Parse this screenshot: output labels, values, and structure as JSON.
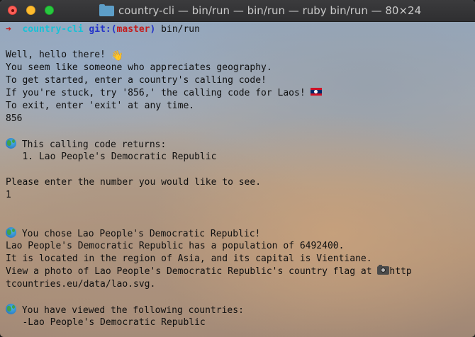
{
  "window": {
    "title": "country-cli — bin/run — bin/run — ruby bin/run — 80×24"
  },
  "prompt": {
    "arrow": "➜",
    "directory": "country-cli",
    "git_label": "git:(",
    "branch": "master",
    "git_close": ")",
    "command": "bin/run"
  },
  "greeting": {
    "hello": "Well, hello there! ",
    "line_geography": "You seem like someone who appreciates geography.",
    "line_start": "To get started, enter a country's calling code!",
    "line_stuck": "If you're stuck, try '856,' the calling code for Laos! ",
    "line_exit": "To exit, enter 'exit' at any time.",
    "input_code": "856"
  },
  "results": {
    "header": " This calling code returns:",
    "item_1": "   1. Lao People's Democratic Republic",
    "prompt_number": "Please enter the number you would like to see.",
    "input_number": "1"
  },
  "detail": {
    "chose": " You chose Lao People's Democratic Republic!",
    "population": "Lao People's Democratic Republic has a population of 6492400.",
    "region": "It is located in the region of Asia, and its capital is Vientiane.",
    "photo_prefix": "View a photo of Lao People's Democratic Republic's country flag at ",
    "photo_url_start": "http",
    "photo_url_end": "tcountries.eu/data/lao.svg."
  },
  "history": {
    "header": " You have viewed the following countries:",
    "item_1": "   -Lao People's Democratic Republic"
  },
  "icons": {
    "wave": "👋",
    "globe": "globe-icon",
    "flag": "laos-flag-icon",
    "camera": "camera-icon"
  },
  "colors": {
    "prompt_arrow": "#c41b1b",
    "prompt_dir": "#19c1d6",
    "prompt_git": "#2433c9",
    "prompt_branch": "#c41b1b",
    "text": "#101010"
  }
}
